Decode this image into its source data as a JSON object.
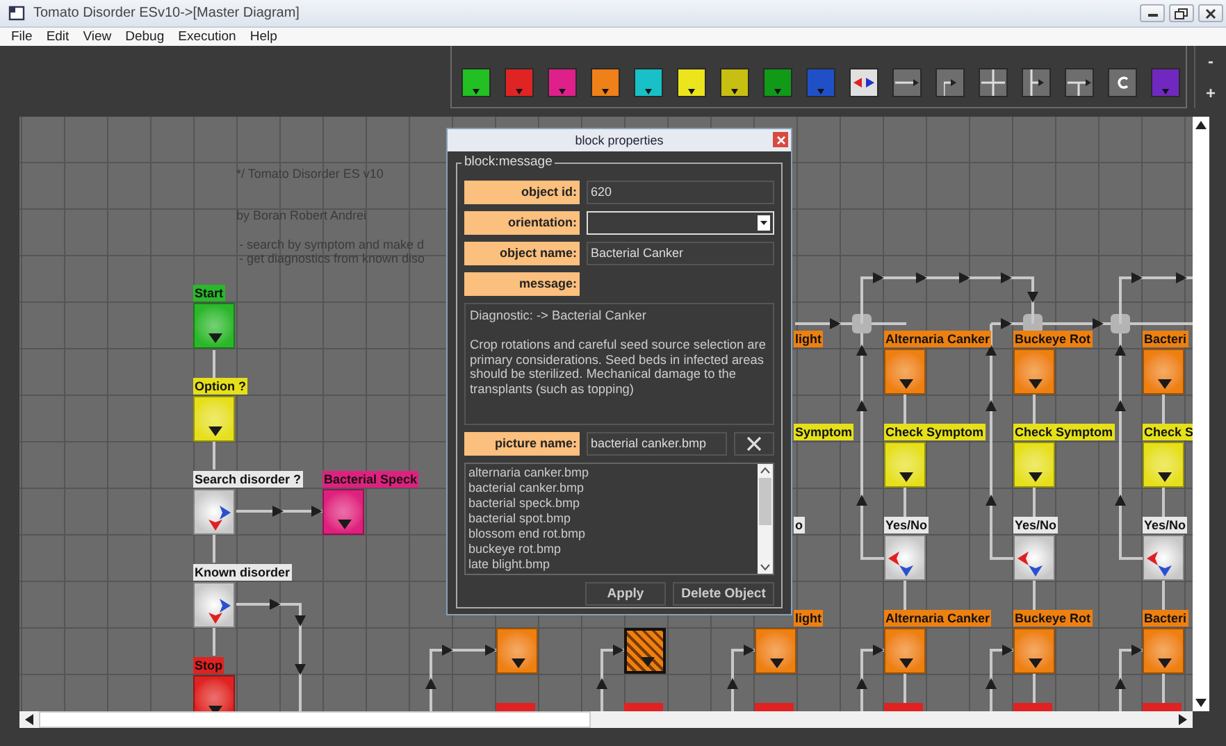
{
  "window": {
    "title": "Tomato Disorder ESv10->[Master Diagram]"
  },
  "menu": [
    "File",
    "Edit",
    "View",
    "Debug",
    "Execution",
    "Help"
  ],
  "palette": {
    "tools": [
      {
        "kind": "block",
        "color": "#22c022"
      },
      {
        "kind": "block",
        "color": "#e02424"
      },
      {
        "kind": "block",
        "color": "#e0208a"
      },
      {
        "kind": "block",
        "color": "#f08018"
      },
      {
        "kind": "block",
        "color": "#18c0c8"
      },
      {
        "kind": "block",
        "color": "#ece41c"
      },
      {
        "kind": "block",
        "color": "#c8c010"
      },
      {
        "kind": "block",
        "color": "#109a18"
      },
      {
        "kind": "block",
        "color": "#2050c8"
      },
      {
        "kind": "decision"
      },
      {
        "kind": "straight"
      },
      {
        "kind": "corner"
      },
      {
        "kind": "cross"
      },
      {
        "kind": "tee"
      },
      {
        "kind": "teedown"
      },
      {
        "kind": "loop"
      },
      {
        "kind": "block",
        "color": "#7028c0"
      }
    ],
    "zoom": [
      "-",
      "+"
    ]
  },
  "diagram": {
    "notes": [
      "*/ Tomato Disorder ES v10",
      "by Boran Robert Andrei",
      "- search by symptom and make d",
      "- get diagnostics from known diso"
    ],
    "nodes": [
      {
        "kind": "block",
        "label": "Start",
        "color": "#2ab82a",
        "selected": false
      },
      {
        "kind": "block",
        "label": "Option ?",
        "color": "#e6e01a",
        "selected": false
      },
      {
        "kind": "decision",
        "label": "Search disorder ?",
        "color": "#e8e8e8",
        "mirrored": false,
        "selected": false
      },
      {
        "kind": "block",
        "label": "Bacterial Speck",
        "color": "#e0207f",
        "selected": false
      },
      {
        "kind": "decision",
        "label": "Known disorder",
        "color": "#e8e8e8",
        "mirrored": false,
        "selected": false
      },
      {
        "kind": "block",
        "label": "Stop",
        "color": "#e02222",
        "selected": false
      },
      {
        "kind": "block",
        "color": "#ee8010",
        "selected": false
      },
      {
        "kind": "block",
        "color": "#ee8010",
        "selected": true
      },
      {
        "kind": "block",
        "color": "#ee8010",
        "selected": false
      },
      {
        "kind": "tag",
        "label": "light",
        "color": "#ee8010"
      },
      {
        "kind": "tag",
        "label": "Symptom",
        "color": "#e6e01a"
      },
      {
        "kind": "tag",
        "label": "o",
        "color": "#e8e8e8"
      },
      {
        "kind": "tag",
        "label": "light",
        "color": "#ee8010"
      },
      {
        "kind": "block",
        "label": "Alternaria Canker",
        "color": "#ee8010",
        "selected": false
      },
      {
        "kind": "block",
        "label": "Check Symptom",
        "color": "#e6e01a",
        "selected": false
      },
      {
        "kind": "decision",
        "label": "Yes/No",
        "color": "#e8e8e8",
        "mirrored": true,
        "selected": false
      },
      {
        "kind": "block",
        "label": "Alternaria Canker",
        "color": "#ee8010",
        "selected": false
      },
      {
        "kind": "tag",
        "color": "#e02222"
      },
      {
        "kind": "block",
        "label": "Buckeye Rot",
        "color": "#ee8010",
        "selected": false
      },
      {
        "kind": "block",
        "label": "Check Symptom",
        "color": "#e6e01a",
        "selected": false
      },
      {
        "kind": "decision",
        "label": "Yes/No",
        "color": "#e8e8e8",
        "mirrored": true,
        "selected": false
      },
      {
        "kind": "block",
        "label": "Buckeye Rot",
        "color": "#ee8010",
        "selected": false
      },
      {
        "kind": "tag",
        "color": "#e02222"
      },
      {
        "kind": "block",
        "label": "Bacteri",
        "color": "#ee8010",
        "selected": false
      },
      {
        "kind": "block",
        "label": "Check S",
        "color": "#e6e01a",
        "selected": false
      },
      {
        "kind": "decision",
        "label": "Yes/No",
        "color": "#e8e8e8",
        "mirrored": true,
        "selected": false
      },
      {
        "kind": "block",
        "label": "Bacteri",
        "color": "#ee8010",
        "selected": false
      },
      {
        "kind": "tag",
        "color": "#e02222"
      },
      {
        "kind": "tag",
        "color": "#e02222"
      },
      {
        "kind": "tag",
        "color": "#e02222"
      },
      {
        "kind": "tag",
        "color": "#e02222"
      }
    ]
  },
  "dialog": {
    "title": "block properties",
    "group": "block:message",
    "fields": [
      {
        "label": "object id:",
        "kind": "text",
        "value": "620"
      },
      {
        "label": "orientation:",
        "kind": "select"
      },
      {
        "label": "object name:",
        "kind": "text",
        "value": "Bacterial Canker"
      },
      {
        "label": "message:",
        "kind": "none"
      }
    ],
    "message": "Diagnostic: -> Bacterial Canker\n\nCrop rotations and careful seed source selection are primary considerations. Seed beds in infected areas should be sterilized. Mechanical damage to the transplants (such as topping)",
    "picture": {
      "label": "picture name:",
      "value": "bacterial canker.bmp"
    },
    "files": [
      "alternaria canker.bmp",
      "bacterial canker.bmp",
      "bacterial speck.bmp",
      "bacterial spot.bmp",
      "blossom end rot.bmp",
      "buckeye rot.bmp",
      "late blight.bmp"
    ],
    "buttons": [
      "Apply",
      "Delete Object"
    ]
  }
}
